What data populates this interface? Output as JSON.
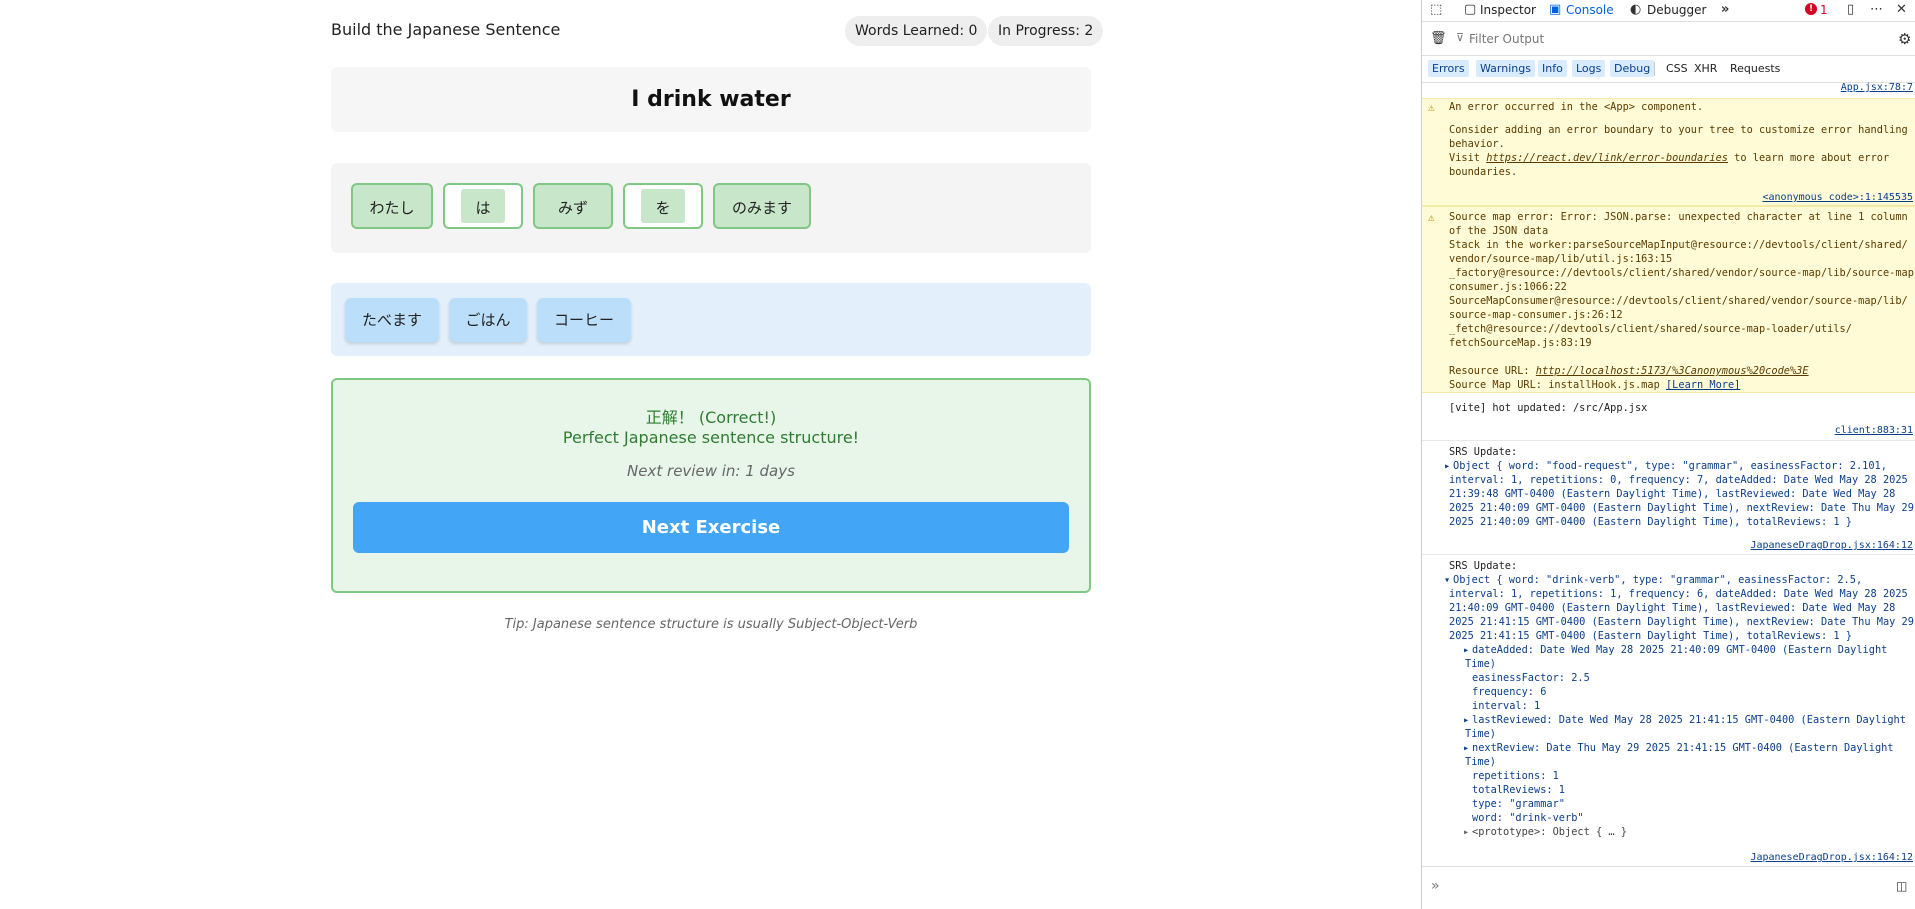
{
  "app": {
    "title": "Build the Japanese Sentence",
    "words_learned": "Words Learned: 0",
    "in_progress": "In Progress: 2",
    "prompt": "I drink water",
    "answer_tiles": [
      "わたし",
      "は",
      "みず",
      "を",
      "のみます"
    ],
    "bank_tiles": [
      "たべます",
      "ごはん",
      "コーヒー"
    ],
    "feedback": {
      "correct": "正解！ (Correct!)",
      "message": "Perfect Japanese sentence structure!",
      "review": "Next review in: 1 days",
      "next_button": "Next Exercise"
    },
    "tip": "Tip: Japanese sentence structure is usually Subject-Object-Verb"
  },
  "devtools": {
    "tabs": {
      "inspector": "Inspector",
      "console": "Console",
      "debugger": "Debugger",
      "error_count": "1"
    },
    "filter_placeholder": "Filter Output",
    "levels": [
      "Errors",
      "Warnings",
      "Info",
      "Logs",
      "Debug"
    ],
    "types": [
      "CSS",
      "XHR",
      "Requests"
    ],
    "logs": {
      "app_link": "App.jsx:78:7",
      "w1_line1": "An error occurred in the <App> component.",
      "w1_line2": "Consider adding an error boundary to your tree to customize error handling",
      "w1_line3": "behavior.",
      "w1_visit": "Visit ",
      "w1_url": "https://react.dev/link/error-boundaries",
      "w1_line4": " to learn more about error",
      "w1_line5": "boundaries.",
      "w1_src": "<anonymous code>:1:145535",
      "w2_lines": [
        "Source map error: Error: JSON.parse: unexpected character at line 1 column 1",
        "of the JSON data",
        "Stack in the worker:parseSourceMapInput@resource://devtools/client/shared/",
        "vendor/source-map/lib/util.js:163:15",
        "_factory@resource://devtools/client/shared/vendor/source-map/lib/source-map-",
        "consumer.js:1066:22",
        "SourceMapConsumer@resource://devtools/client/shared/vendor/source-map/lib/",
        "source-map-consumer.js:26:12",
        "_fetch@resource://devtools/client/shared/source-map-loader/utils/",
        "fetchSourceMap.js:83:19"
      ],
      "w2_resource_label": "Resource URL: ",
      "w2_resource_url": "http://localhost:5173/%3Canonymous%20code%3E",
      "w2_sourcemap": "Source Map URL: installHook.js.map ",
      "w2_learn": "[Learn More]",
      "vite": "[vite] hot updated: /src/App.jsx",
      "client_link": "client:883:31",
      "srs1_label": "SRS Update:",
      "srs1_lines": [
        "Object { word: \"food-request\", type: \"grammar\", easinessFactor: 2.101,",
        "interval: 1, repetitions: 0, frequency: 7, dateAdded: Date Wed May 28 2025",
        "21:39:48 GMT-0400 (Eastern Daylight Time), lastReviewed: Date Wed May 28",
        "2025 21:40:09 GMT-0400 (Eastern Daylight Time), nextReview: Date Thu May 29",
        "2025 21:40:09 GMT-0400 (Eastern Daylight Time), totalReviews: 1 }"
      ],
      "srs1_link": "JapaneseDragDrop.jsx:164:12",
      "srs2_label": "SRS Update:",
      "srs2_lines": [
        "Object { word: \"drink-verb\", type: \"grammar\", easinessFactor: 2.5,",
        "interval: 1, repetitions: 1, frequency: 6, dateAdded: Date Wed May 28 2025",
        "21:40:09 GMT-0400 (Eastern Daylight Time), lastReviewed: Date Wed May 28",
        "2025 21:41:15 GMT-0400 (Eastern Daylight Time), nextReview: Date Thu May 29",
        "2025 21:41:15 GMT-0400 (Eastern Daylight Time), totalReviews: 1 }"
      ],
      "props": [
        "dateAdded: Date Wed May 28 2025 21:40:09 GMT-0400 (Eastern Daylight",
        "Time)",
        "easinessFactor: 2.5",
        "frequency: 6",
        "interval: 1",
        "lastReviewed: Date Wed May 28 2025 21:41:15 GMT-0400 (Eastern Daylight",
        "Time)",
        "nextReview: Date Thu May 29 2025 21:41:15 GMT-0400 (Eastern Daylight",
        "Time)",
        "repetitions: 1",
        "totalReviews: 1",
        "type: \"grammar\"",
        "word: \"drink-verb\"",
        "<prototype>: Object { … }"
      ],
      "srs2_link": "JapaneseDragDrop.jsx:164:12"
    }
  }
}
